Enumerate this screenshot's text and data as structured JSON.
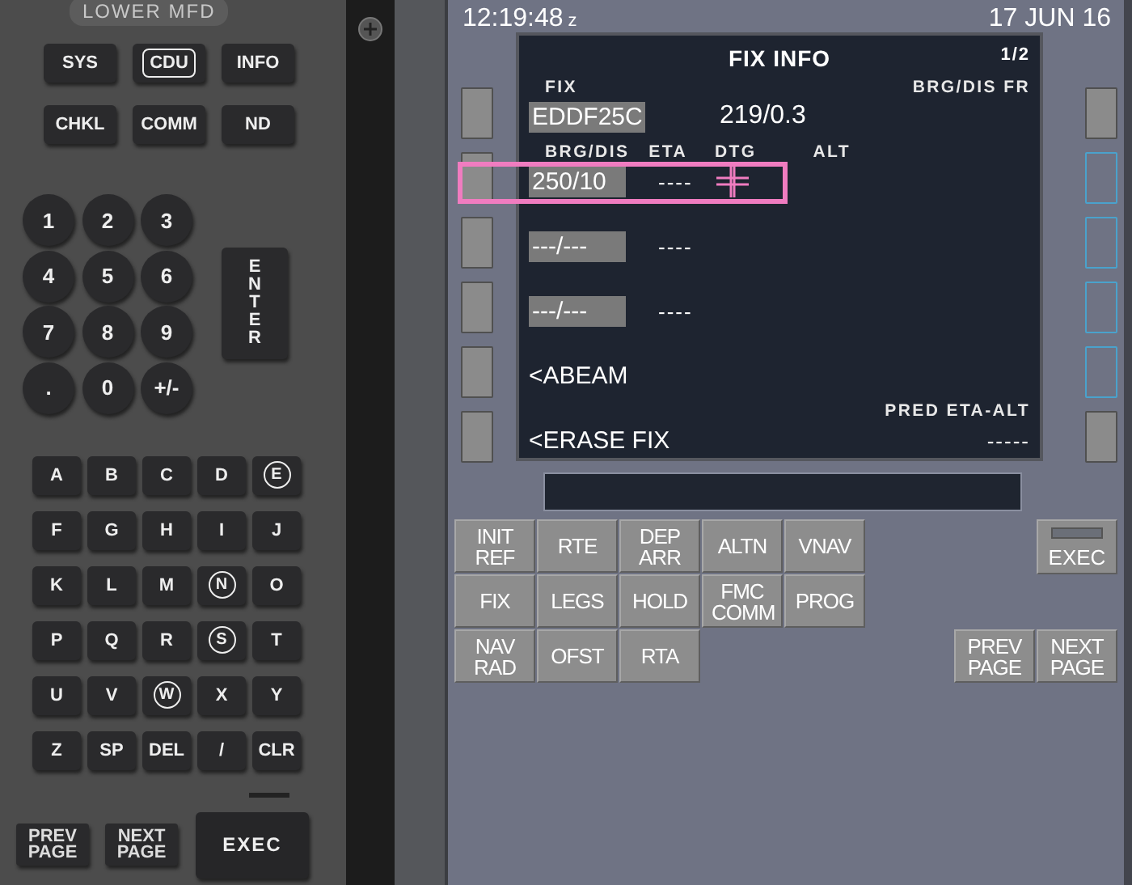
{
  "lower_mfd": {
    "title": "LOWER MFD",
    "mode_buttons": [
      {
        "label": "SYS",
        "selected": false
      },
      {
        "label": "CDU",
        "selected": true
      },
      {
        "label": "INFO",
        "selected": false
      },
      {
        "label": "CHKL",
        "selected": false
      },
      {
        "label": "COMM",
        "selected": false
      },
      {
        "label": "ND",
        "selected": false
      }
    ],
    "numpad": [
      "1",
      "2",
      "3",
      "4",
      "5",
      "6",
      "7",
      "8",
      "9",
      ".",
      "0",
      "+/-"
    ],
    "enter_key": "ENTER",
    "alpha_keys": [
      {
        "label": "A",
        "circled": false
      },
      {
        "label": "B",
        "circled": false
      },
      {
        "label": "C",
        "circled": false
      },
      {
        "label": "D",
        "circled": false
      },
      {
        "label": "E",
        "circled": true
      },
      {
        "label": "F",
        "circled": false
      },
      {
        "label": "G",
        "circled": false
      },
      {
        "label": "H",
        "circled": false
      },
      {
        "label": "I",
        "circled": false
      },
      {
        "label": "J",
        "circled": false
      },
      {
        "label": "K",
        "circled": false
      },
      {
        "label": "L",
        "circled": false
      },
      {
        "label": "M",
        "circled": false
      },
      {
        "label": "N",
        "circled": true
      },
      {
        "label": "O",
        "circled": false
      },
      {
        "label": "P",
        "circled": false
      },
      {
        "label": "Q",
        "circled": false
      },
      {
        "label": "R",
        "circled": false
      },
      {
        "label": "S",
        "circled": true
      },
      {
        "label": "T",
        "circled": false
      },
      {
        "label": "U",
        "circled": false
      },
      {
        "label": "V",
        "circled": false
      },
      {
        "label": "W",
        "circled": true
      },
      {
        "label": "X",
        "circled": false
      },
      {
        "label": "Y",
        "circled": false
      },
      {
        "label": "Z",
        "circled": false
      },
      {
        "label": "SP",
        "circled": false
      },
      {
        "label": "DEL",
        "circled": false
      },
      {
        "label": "/",
        "circled": false
      },
      {
        "label": "CLR",
        "circled": false
      }
    ],
    "page_keys": [
      "PREV PAGE",
      "NEXT PAGE"
    ],
    "exec_key": "EXEC"
  },
  "cdu": {
    "time": "12:19:48",
    "time_suffix": "z",
    "date": "17 JUN 16",
    "screen": {
      "title": "FIX INFO",
      "page": "1/2",
      "lines": [
        {
          "labels": [
            "FIX"
          ],
          "label_right": "BRG/DIS FR",
          "left": "EDDF25C",
          "left_boxed": true,
          "center": "219/0.3",
          "highlighted": false
        },
        {
          "labels": [
            "BRG/DIS",
            "ETA",
            "DTG",
            "ALT"
          ],
          "left": "250/10",
          "left_boxed": true,
          "eta": "----",
          "highlighted": true
        },
        {
          "left": "---/---",
          "left_boxed": true,
          "eta": "----",
          "highlighted": false
        },
        {
          "left": "---/---",
          "left_boxed": true,
          "eta": "----",
          "highlighted": false
        },
        {
          "left": "<ABEAM",
          "left_boxed": false,
          "highlighted": false
        },
        {
          "label_right": "PRED ETA-ALT",
          "left": "<ERASE FIX",
          "left_boxed": false,
          "right": "-----",
          "highlighted": false
        }
      ],
      "right_keys": [
        {
          "kind": "key"
        },
        {
          "kind": "empty"
        },
        {
          "kind": "empty"
        },
        {
          "kind": "empty"
        },
        {
          "kind": "empty"
        },
        {
          "kind": "key"
        }
      ]
    },
    "function_keys": [
      "INIT REF",
      "RTE",
      "DEP ARR",
      "ALTN",
      "VNAV",
      "FIX",
      "LEGS",
      "HOLD",
      "FMC COMM",
      "PROG",
      "NAV RAD",
      "OFST",
      "RTA"
    ],
    "exec_key": "EXEC",
    "page_keys": [
      "PREV PAGE",
      "NEXT PAGE"
    ]
  }
}
